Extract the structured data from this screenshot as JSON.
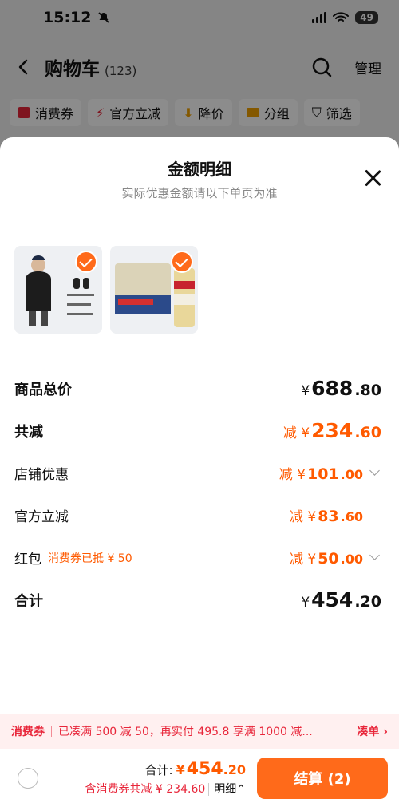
{
  "status_bar": {
    "time": "15:12",
    "battery": "49"
  },
  "header": {
    "title": "购物车",
    "count": "(123)",
    "manage_label": "管理"
  },
  "filters": [
    {
      "label": "消费券",
      "icon": "coupon-icon"
    },
    {
      "label": "官方立减",
      "icon": "lightning-icon"
    },
    {
      "label": "降价",
      "icon": "down-arrow-icon"
    },
    {
      "label": "分组",
      "icon": "folder-icon"
    },
    {
      "label": "筛选",
      "icon": "filter-icon"
    }
  ],
  "sheet": {
    "title": "金额明细",
    "subtitle": "实际优惠金额请以下单页为准",
    "products": [
      {
        "name": "jacket",
        "checked": true
      },
      {
        "name": "beer-pack",
        "checked": true
      }
    ],
    "rows": {
      "goods_total": {
        "label": "商品总价",
        "prefix": "¥",
        "int": "688",
        "dec": ".80"
      },
      "total_reduction": {
        "label": "共减",
        "prefix": "减 ¥",
        "int": "234",
        "dec": ".60"
      },
      "store_discount": {
        "label": "店铺优惠",
        "prefix": "减 ¥",
        "int": "101",
        "dec": ".00"
      },
      "official_reduction": {
        "label": "官方立减",
        "prefix": "减 ¥",
        "int": "83",
        "dec": ".60"
      },
      "red_packet": {
        "label": "红包",
        "hint": "消费券已抵 ¥ 50",
        "prefix": "减 ¥",
        "int": "50",
        "dec": ".00"
      },
      "subtotal": {
        "label": "合计",
        "prefix": "¥",
        "int": "454",
        "dec": ".20"
      }
    }
  },
  "promo": {
    "tag": "消费券",
    "text": "已凑满 500 减 50，再实付 495.8 享满 1000 减...",
    "link": "凑单 ›"
  },
  "bottom_bar": {
    "total_label": "合计:",
    "total_prefix": "¥",
    "total_int": "454",
    "total_dec": ".20",
    "discount_text": "含消费券共减 ¥ 234.60",
    "detail_label": "明细⌃",
    "checkout_label": "结算 (2)"
  },
  "colors": {
    "accent": "#ff6a1a",
    "discount": "#ff5a00",
    "promo_red": "#e8263a"
  }
}
